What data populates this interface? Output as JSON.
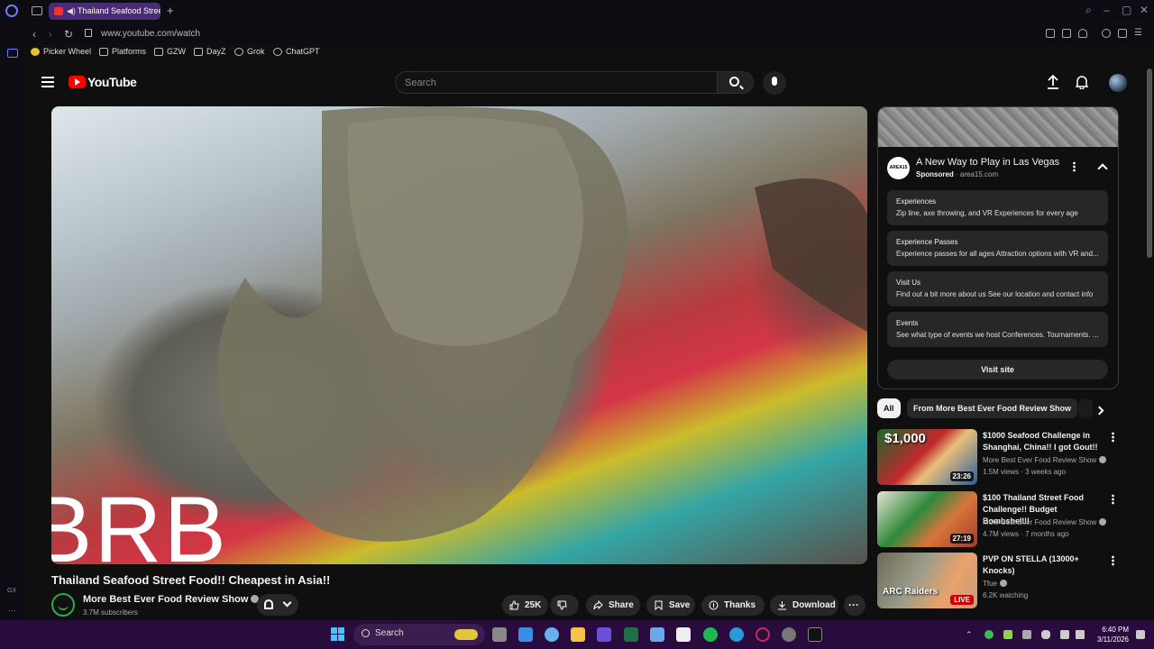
{
  "browser": {
    "tab_title": "Thailand Seafood Stree",
    "url": "www.youtube.com/watch",
    "new_tab_label": "+",
    "bookmarks": [
      "Picker Wheel",
      "Platforms",
      "GZW",
      "DayZ",
      "Grok",
      "ChatGPT"
    ],
    "sidebar_label": "GX"
  },
  "youtube": {
    "logo_text": "YouTube",
    "search_placeholder": "Search"
  },
  "video": {
    "overlay_text": "BRB",
    "title": "Thailand Seafood Street Food!! Cheapest in Asia!!",
    "channel": "More Best Ever Food Review Show",
    "subscribers": "3.7M subscribers",
    "actions": {
      "likes": "25K",
      "share": "Share",
      "save": "Save",
      "thanks": "Thanks",
      "download": "Download"
    }
  },
  "ad": {
    "logo": "AREA15",
    "title": "A New Way to Play in Las Vegas",
    "sponsored": "Sponsored",
    "domain": "· area15.com",
    "items": [
      {
        "title": "Experiences",
        "desc": "Zip line, axe throwing, and VR Experiences for every age"
      },
      {
        "title": "Experience Passes",
        "desc": "Experience passes for all ages Attraction options with VR and..."
      },
      {
        "title": "Visit Us",
        "desc": "Find out a bit more about us See our location and contact info"
      },
      {
        "title": "Events",
        "desc": "See what type of events we host Conferences. Tournaments. ..."
      }
    ],
    "cta": "Visit site"
  },
  "chips": [
    "All",
    "From More Best Ever Food Review Show"
  ],
  "recommendations": [
    {
      "title": "$1000 Seafood Challenge in Shanghai, China!! I got Gout!!",
      "channel": "More Best Ever Food Review Show",
      "meta": "1.5M views · 3 weeks ago",
      "duration": "23:26",
      "thumb_text": "$1,000"
    },
    {
      "title": "$100 Thailand Street Food Challenge!! Budget Bombshell!!",
      "channel": "More Best Ever Food Review Show",
      "meta": "4.7M views · 7 months ago",
      "duration": "27:19",
      "thumb_text": ""
    },
    {
      "title": "PVP ON STELLA (13000+ Knocks)",
      "channel": "Tfue",
      "meta": "6.2K watching",
      "duration": "LIVE",
      "thumb_text": "ARC Raiders"
    }
  ],
  "taskbar": {
    "search_label": "Search",
    "time": "6:40 PM",
    "date": "3/11/2026"
  },
  "colors": {
    "yt_red": "#ff0000",
    "browser_tab_active": "#4b2a7a",
    "taskbar": "#2a0b3d"
  }
}
